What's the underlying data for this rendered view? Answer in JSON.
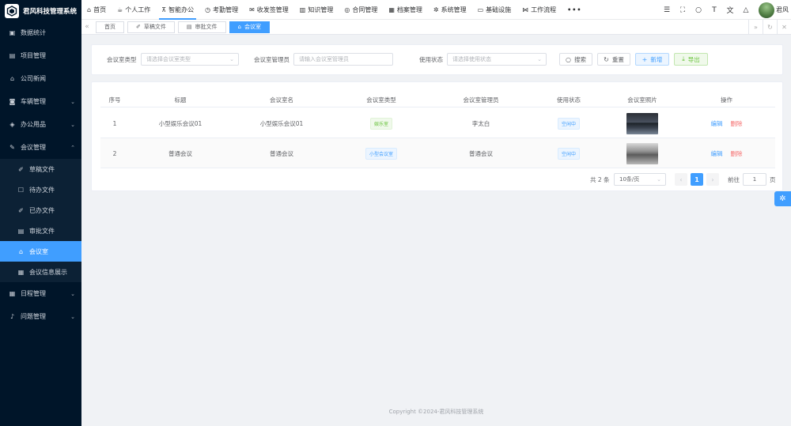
{
  "app": {
    "title": "君风科技管理系统"
  },
  "sidebar": {
    "items": [
      {
        "label": "数据统计",
        "icon": "dashboard-icon"
      },
      {
        "label": "项目管理",
        "icon": "document-icon"
      },
      {
        "label": "公司新闻",
        "icon": "bank-icon"
      },
      {
        "label": "车辆管理",
        "icon": "car-icon",
        "expandable": true
      },
      {
        "label": "办公用品",
        "icon": "box-icon",
        "expandable": true
      },
      {
        "label": "会议管理",
        "icon": "pen-icon",
        "expandable": true,
        "expanded": true
      }
    ],
    "submenu": [
      {
        "label": "草稿文件",
        "icon": "edit-icon"
      },
      {
        "label": "待办文件",
        "icon": "edit-box-icon"
      },
      {
        "label": "已办文件",
        "icon": "edit-icon"
      },
      {
        "label": "审批文件",
        "icon": "document-icon"
      },
      {
        "label": "会议室",
        "icon": "home-icon",
        "active": true
      },
      {
        "label": "会议信息展示",
        "icon": "calendar-icon"
      }
    ],
    "items_after": [
      {
        "label": "日程管理",
        "icon": "calendar-icon",
        "expandable": true
      },
      {
        "label": "问题管理",
        "icon": "bell-icon",
        "expandable": true
      }
    ]
  },
  "topnav": {
    "items": [
      {
        "label": "首页",
        "icon": "home-icon"
      },
      {
        "label": "个人工作",
        "icon": "cup-icon"
      },
      {
        "label": "智能办公",
        "icon": "desk-icon",
        "active": true
      },
      {
        "label": "考勤管理",
        "icon": "clock-icon"
      },
      {
        "label": "收发签管理",
        "icon": "mail-icon"
      },
      {
        "label": "知识管理",
        "icon": "book-icon"
      },
      {
        "label": "合同管理",
        "icon": "coins-icon"
      },
      {
        "label": "档案管理",
        "icon": "grid-icon"
      },
      {
        "label": "系统管理",
        "icon": "gear-icon"
      },
      {
        "label": "基础设施",
        "icon": "monitor-icon"
      },
      {
        "label": "工作流程",
        "icon": "flow-icon"
      }
    ],
    "more": "•••",
    "user": {
      "name": "君风"
    }
  },
  "tags": [
    {
      "label": "首页",
      "active": false
    },
    {
      "label": "草稿文件",
      "active": false
    },
    {
      "label": "审批文件",
      "active": false
    },
    {
      "label": "会议室",
      "active": true
    }
  ],
  "filters": {
    "room_type": {
      "label": "会议室类型",
      "placeholder": "请选择会议室类型"
    },
    "manager": {
      "label": "会议室管理员",
      "placeholder": "请输入会议室管理员"
    },
    "status": {
      "label": "使用状态",
      "placeholder": "请选择使用状态"
    },
    "buttons": {
      "search": "搜索",
      "reset": "重置",
      "add": "新增",
      "export": "导出"
    }
  },
  "table": {
    "columns": [
      "序号",
      "标题",
      "会议室名",
      "会议室类型",
      "会议室管理员",
      "使用状态",
      "会议室照片",
      "操作"
    ],
    "rows": [
      {
        "index": "1",
        "title": "小型娱乐会议01",
        "name": "小型娱乐会议01",
        "type": "娱乐室",
        "manager": "李太白",
        "status": "空闲中"
      },
      {
        "index": "2",
        "title": "普通会议",
        "name": "普通会议",
        "type": "小型会议室",
        "manager": "普通会议",
        "status": "空闲中"
      }
    ],
    "actions": {
      "edit": "编辑",
      "delete": "删除"
    }
  },
  "pagination": {
    "total_text": "共 2 条",
    "page_size": "10条/页",
    "current_page": "1",
    "goto_label": "前往",
    "goto_value": "1",
    "page_suffix": "页"
  },
  "footer": {
    "text": "Copyright ©2024-君风科技管理系统"
  },
  "colors": {
    "primary": "#409eff",
    "sidebar_bg": "#001529",
    "danger": "#f56c6c",
    "success": "#67c23a"
  }
}
